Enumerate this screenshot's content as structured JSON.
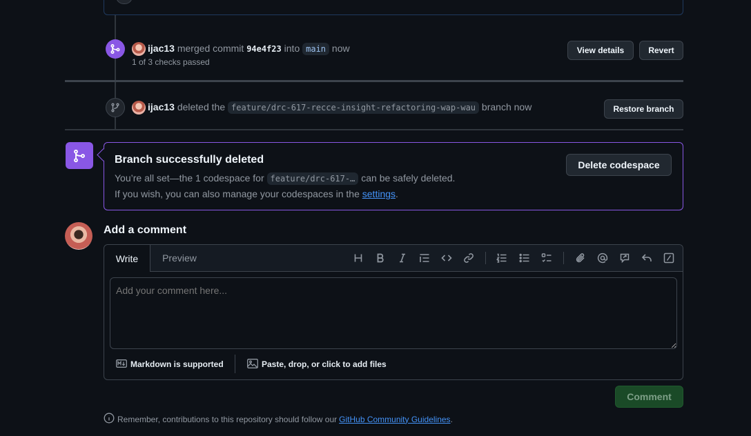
{
  "timeline": {
    "merge_event": {
      "user": "ijac13",
      "action": "merged commit",
      "commit": "94e4f23",
      "into": "into",
      "branch": "main",
      "time": "now",
      "checks": "1 of 3 checks passed",
      "view_details_label": "View details",
      "revert_label": "Revert"
    },
    "delete_event": {
      "user": "ijac13",
      "action": "deleted the",
      "branch": "feature/drc-617-recce-insight-refactoring-wap-wau",
      "suffix": "branch now",
      "restore_label": "Restore branch"
    }
  },
  "codespace_box": {
    "title": "Branch successfully deleted",
    "line1_prefix": "You’re all set—the 1 codespace for",
    "line1_branch": "feature/drc-617-…",
    "line1_suffix": "can be safely deleted.",
    "line2_prefix": "If you wish, you can also manage your codespaces in the",
    "line2_link": "settings",
    "line2_end": ".",
    "delete_label": "Delete codespace"
  },
  "comment": {
    "heading": "Add a comment",
    "tabs": [
      "Write",
      "Preview"
    ],
    "placeholder": "Add your comment here...",
    "markdown_label": "Markdown is supported",
    "attach_label": "Paste, drop, or click to add files",
    "submit_label": "Comment",
    "toolbar_icons": [
      "heading-icon",
      "bold-icon",
      "italic-icon",
      "quote-icon",
      "code-icon",
      "link-icon",
      "ordered-list-icon",
      "unordered-list-icon",
      "task-list-icon",
      "attach-icon",
      "mention-icon",
      "reference-icon",
      "reply-icon",
      "slash-command-icon"
    ]
  },
  "footer": {
    "prefix": "Remember, contributions to this repository should follow our",
    "link": "GitHub Community Guidelines",
    "end": "."
  },
  "colors": {
    "background": "#0d1117",
    "accent_purple": "#8957e5",
    "link_blue": "#4493f8",
    "comment_button_bg": "#1a4a27"
  }
}
